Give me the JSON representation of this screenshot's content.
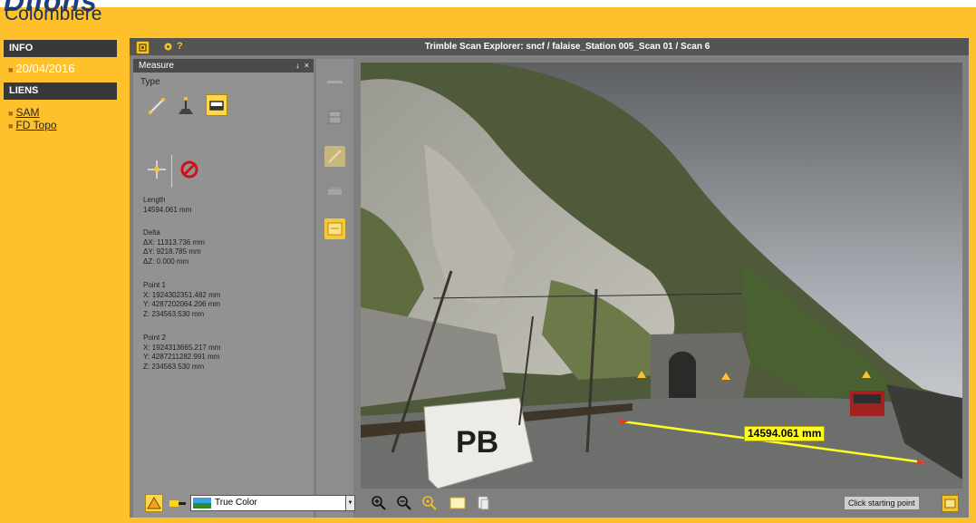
{
  "page": {
    "title_fragment": "Dilons",
    "subtitle": "Colombiere"
  },
  "sidebar": {
    "info_header": "INFO",
    "date": "20/04/2016",
    "links_header": "LIENS",
    "links": [
      "SAM",
      "FD Topo"
    ]
  },
  "app": {
    "title": "Trimble Scan Explorer: sncf / falaise_Station 005_Scan 01 / Scan 6",
    "measure_panel": {
      "title": "Measure",
      "pin": "↓",
      "close": "×",
      "type_label": "Type",
      "tools": [
        "distance-tool-icon",
        "height-tool-icon",
        "area-tool-icon",
        "crosshair-icon",
        "cancel-icon"
      ],
      "length_label": "Length",
      "length_value": "14594.061 mm",
      "delta_label": "Delta",
      "delta_x": "ΔX: 11313.736 mm",
      "delta_y": "ΔY: 9218.785 mm",
      "delta_z": "ΔZ: 0.000 mm",
      "point1_label": "Point 1",
      "point1_x": "X: 1924302351.482 mm",
      "point1_y": "Y: 4287202064.206 mm",
      "point1_z": "Z: 234563.530 mm",
      "point2_label": "Point 2",
      "point2_x": "X: 1924313665.217 mm",
      "point2_y": "Y: 4287211282.991 mm",
      "point2_z": "Z: 234563.530 mm"
    },
    "viewport": {
      "measurement_label": "14594.061 mm"
    },
    "bottom_bar": {
      "color_mode": "True Color",
      "status": "Click starting point"
    }
  },
  "colors": {
    "page_background": "#fec12c",
    "sidebar_header": "#383838",
    "title_bar": "#545454",
    "panel": "#929292",
    "accent_yellow": "#ffd74e",
    "measure_line": "#ffff1e"
  }
}
